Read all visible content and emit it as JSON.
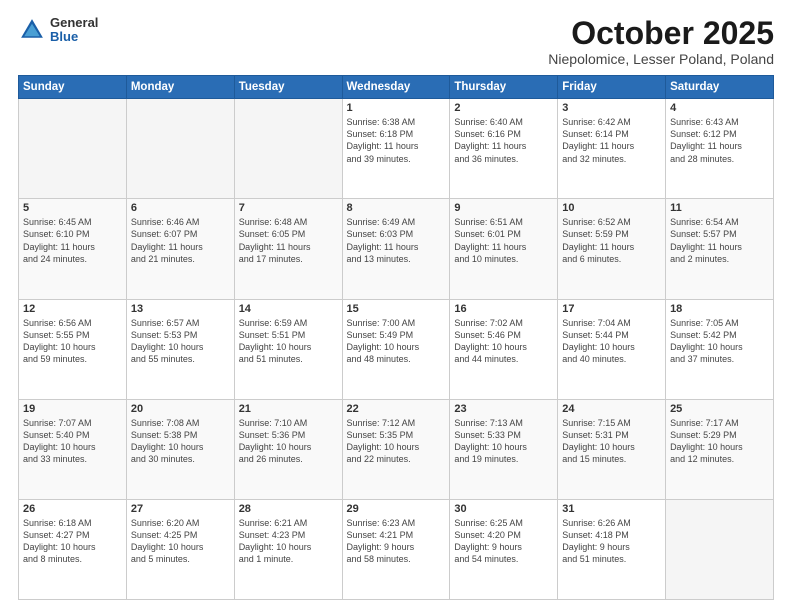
{
  "logo": {
    "general": "General",
    "blue": "Blue"
  },
  "header": {
    "month": "October 2025",
    "location": "Niepolomice, Lesser Poland, Poland"
  },
  "weekdays": [
    "Sunday",
    "Monday",
    "Tuesday",
    "Wednesday",
    "Thursday",
    "Friday",
    "Saturday"
  ],
  "weeks": [
    [
      {
        "day": "",
        "info": ""
      },
      {
        "day": "",
        "info": ""
      },
      {
        "day": "",
        "info": ""
      },
      {
        "day": "1",
        "info": "Sunrise: 6:38 AM\nSunset: 6:18 PM\nDaylight: 11 hours\nand 39 minutes."
      },
      {
        "day": "2",
        "info": "Sunrise: 6:40 AM\nSunset: 6:16 PM\nDaylight: 11 hours\nand 36 minutes."
      },
      {
        "day": "3",
        "info": "Sunrise: 6:42 AM\nSunset: 6:14 PM\nDaylight: 11 hours\nand 32 minutes."
      },
      {
        "day": "4",
        "info": "Sunrise: 6:43 AM\nSunset: 6:12 PM\nDaylight: 11 hours\nand 28 minutes."
      }
    ],
    [
      {
        "day": "5",
        "info": "Sunrise: 6:45 AM\nSunset: 6:10 PM\nDaylight: 11 hours\nand 24 minutes."
      },
      {
        "day": "6",
        "info": "Sunrise: 6:46 AM\nSunset: 6:07 PM\nDaylight: 11 hours\nand 21 minutes."
      },
      {
        "day": "7",
        "info": "Sunrise: 6:48 AM\nSunset: 6:05 PM\nDaylight: 11 hours\nand 17 minutes."
      },
      {
        "day": "8",
        "info": "Sunrise: 6:49 AM\nSunset: 6:03 PM\nDaylight: 11 hours\nand 13 minutes."
      },
      {
        "day": "9",
        "info": "Sunrise: 6:51 AM\nSunset: 6:01 PM\nDaylight: 11 hours\nand 10 minutes."
      },
      {
        "day": "10",
        "info": "Sunrise: 6:52 AM\nSunset: 5:59 PM\nDaylight: 11 hours\nand 6 minutes."
      },
      {
        "day": "11",
        "info": "Sunrise: 6:54 AM\nSunset: 5:57 PM\nDaylight: 11 hours\nand 2 minutes."
      }
    ],
    [
      {
        "day": "12",
        "info": "Sunrise: 6:56 AM\nSunset: 5:55 PM\nDaylight: 10 hours\nand 59 minutes."
      },
      {
        "day": "13",
        "info": "Sunrise: 6:57 AM\nSunset: 5:53 PM\nDaylight: 10 hours\nand 55 minutes."
      },
      {
        "day": "14",
        "info": "Sunrise: 6:59 AM\nSunset: 5:51 PM\nDaylight: 10 hours\nand 51 minutes."
      },
      {
        "day": "15",
        "info": "Sunrise: 7:00 AM\nSunset: 5:49 PM\nDaylight: 10 hours\nand 48 minutes."
      },
      {
        "day": "16",
        "info": "Sunrise: 7:02 AM\nSunset: 5:46 PM\nDaylight: 10 hours\nand 44 minutes."
      },
      {
        "day": "17",
        "info": "Sunrise: 7:04 AM\nSunset: 5:44 PM\nDaylight: 10 hours\nand 40 minutes."
      },
      {
        "day": "18",
        "info": "Sunrise: 7:05 AM\nSunset: 5:42 PM\nDaylight: 10 hours\nand 37 minutes."
      }
    ],
    [
      {
        "day": "19",
        "info": "Sunrise: 7:07 AM\nSunset: 5:40 PM\nDaylight: 10 hours\nand 33 minutes."
      },
      {
        "day": "20",
        "info": "Sunrise: 7:08 AM\nSunset: 5:38 PM\nDaylight: 10 hours\nand 30 minutes."
      },
      {
        "day": "21",
        "info": "Sunrise: 7:10 AM\nSunset: 5:36 PM\nDaylight: 10 hours\nand 26 minutes."
      },
      {
        "day": "22",
        "info": "Sunrise: 7:12 AM\nSunset: 5:35 PM\nDaylight: 10 hours\nand 22 minutes."
      },
      {
        "day": "23",
        "info": "Sunrise: 7:13 AM\nSunset: 5:33 PM\nDaylight: 10 hours\nand 19 minutes."
      },
      {
        "day": "24",
        "info": "Sunrise: 7:15 AM\nSunset: 5:31 PM\nDaylight: 10 hours\nand 15 minutes."
      },
      {
        "day": "25",
        "info": "Sunrise: 7:17 AM\nSunset: 5:29 PM\nDaylight: 10 hours\nand 12 minutes."
      }
    ],
    [
      {
        "day": "26",
        "info": "Sunrise: 6:18 AM\nSunset: 4:27 PM\nDaylight: 10 hours\nand 8 minutes."
      },
      {
        "day": "27",
        "info": "Sunrise: 6:20 AM\nSunset: 4:25 PM\nDaylight: 10 hours\nand 5 minutes."
      },
      {
        "day": "28",
        "info": "Sunrise: 6:21 AM\nSunset: 4:23 PM\nDaylight: 10 hours\nand 1 minute."
      },
      {
        "day": "29",
        "info": "Sunrise: 6:23 AM\nSunset: 4:21 PM\nDaylight: 9 hours\nand 58 minutes."
      },
      {
        "day": "30",
        "info": "Sunrise: 6:25 AM\nSunset: 4:20 PM\nDaylight: 9 hours\nand 54 minutes."
      },
      {
        "day": "31",
        "info": "Sunrise: 6:26 AM\nSunset: 4:18 PM\nDaylight: 9 hours\nand 51 minutes."
      },
      {
        "day": "",
        "info": ""
      }
    ]
  ]
}
